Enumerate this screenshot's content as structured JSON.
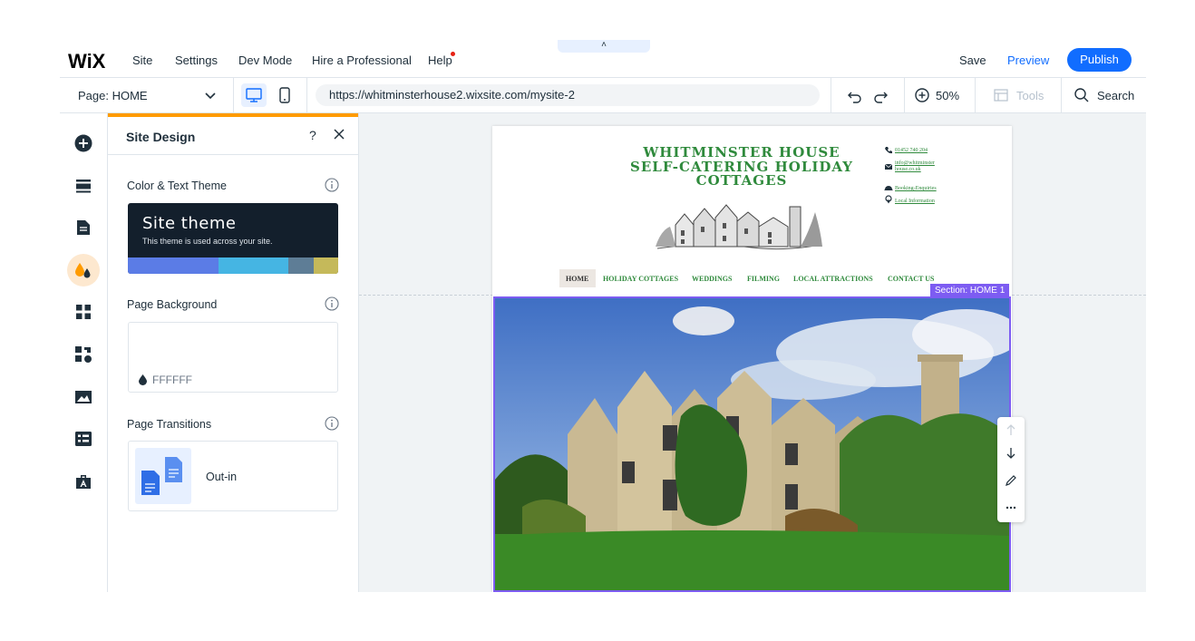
{
  "topbar": {
    "logo": "WiX",
    "menu": [
      "Site",
      "Settings",
      "Dev Mode",
      "Hire a Professional",
      "Help"
    ],
    "pull_tab": "˄",
    "save": "Save",
    "preview": "Preview",
    "publish": "Publish"
  },
  "subbar": {
    "page_label": "Page: HOME",
    "url": "https://whitminsterhouse2.wixsite.com/mysite-2",
    "zoom": "50%",
    "tools": "Tools",
    "search": "Search"
  },
  "rail": {
    "icons": [
      "add-icon",
      "sections-icon",
      "pages-icon",
      "site-design-icon",
      "apps-icon",
      "business-icon",
      "media-icon",
      "cms-icon",
      "portfolio-icon"
    ],
    "active_index": 3
  },
  "panel": {
    "title": "Site Design",
    "help": "?",
    "color_theme_label": "Color & Text Theme",
    "theme_name": "Site theme",
    "theme_desc": "This theme is used across your site.",
    "swatches": [
      "#5b7ce6",
      "#45b5e3",
      "#5e7d96",
      "#c5b95a"
    ],
    "page_background_label": "Page Background",
    "background_value": "FFFFFF",
    "page_transitions_label": "Page Transitions",
    "transition_value": "Out-in"
  },
  "site": {
    "title_lines": [
      "WHITMINSTER HOUSE",
      "SELF-CATERING HOLIDAY",
      "COTTAGES"
    ],
    "contacts": [
      "01452 740 204",
      "info@whitminster",
      "house.co.uk",
      "Booking-Enquiries",
      "Local Information"
    ],
    "nav": [
      "HOME",
      "HOLIDAY COTTAGES",
      "WEDDINGS",
      "FILMING",
      "LOCAL ATTRACTIONS",
      "CONTACT US"
    ],
    "section_badge": "Section: HOME 1"
  },
  "colors": {
    "accent": "#116dff",
    "panel_accent": "#ff9b00",
    "selection": "#7d5cf2",
    "site_green": "#2f8a3c"
  }
}
